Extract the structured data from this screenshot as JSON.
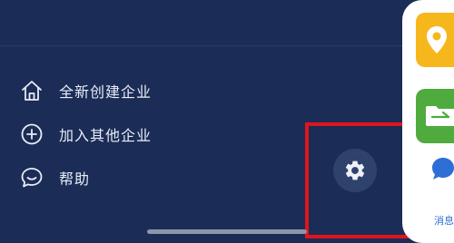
{
  "menu": {
    "items": [
      {
        "label": "全新创建企业",
        "icon": "home-icon"
      },
      {
        "label": "加入其他企业",
        "icon": "plus-circle-icon"
      },
      {
        "label": "帮助",
        "icon": "chat-bubble-icon"
      }
    ]
  },
  "settings": {
    "icon": "gear-icon"
  },
  "side_panel": {
    "tiles": [
      {
        "icon": "location-pin-icon",
        "color": "#f6b71c"
      },
      {
        "icon": "folder-icon",
        "color": "#4fab3e"
      }
    ],
    "message_label": "消息"
  },
  "colors": {
    "background": "#1b2c56",
    "highlight": "#e0141d",
    "accent": "#2d6fd6"
  }
}
